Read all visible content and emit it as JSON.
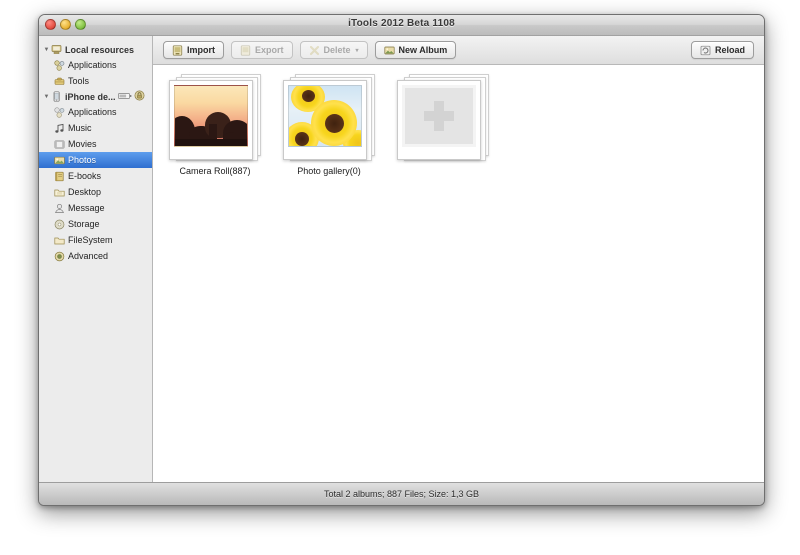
{
  "window": {
    "title": "iTools 2012 Beta 1108",
    "controls": {
      "close": "close",
      "minimize": "minimize",
      "zoom": "zoom"
    }
  },
  "sidebar": {
    "groups": [
      {
        "label": "Local resources",
        "icon": "computer-icon",
        "expanded": true,
        "items": [
          {
            "label": "Applications",
            "icon": "applications-icon",
            "selected": false
          },
          {
            "label": "Tools",
            "icon": "tools-icon",
            "selected": false
          }
        ]
      },
      {
        "label": "iPhone de...",
        "icon": "iphone-icon",
        "expanded": true,
        "battery": "battery-icon",
        "lock": "lock-icon",
        "items": [
          {
            "label": "Applications",
            "icon": "applications-icon",
            "selected": false
          },
          {
            "label": "Music",
            "icon": "music-note-icon",
            "selected": false
          },
          {
            "label": "Movies",
            "icon": "movies-icon",
            "selected": false
          },
          {
            "label": "Photos",
            "icon": "photos-icon",
            "selected": true
          },
          {
            "label": "E-books",
            "icon": "ebooks-icon",
            "selected": false
          },
          {
            "label": "Desktop",
            "icon": "desktop-folder-icon",
            "selected": false
          },
          {
            "label": "Message",
            "icon": "message-icon",
            "selected": false
          },
          {
            "label": "Storage",
            "icon": "storage-icon",
            "selected": false
          },
          {
            "label": "FileSystem",
            "icon": "filesystem-folder-icon",
            "selected": false
          },
          {
            "label": "Advanced",
            "icon": "advanced-gear-icon",
            "selected": false
          }
        ]
      }
    ]
  },
  "toolbar": {
    "import_label": "Import",
    "export_label": "Export",
    "delete_label": "Delete",
    "delete_caret": "▾",
    "new_album_label": "New Album",
    "reload_label": "Reload"
  },
  "albums": [
    {
      "label": "Camera Roll(887)",
      "thumb": "sunset-photo",
      "count": 887
    },
    {
      "label": "Photo gallery(0)",
      "thumb": "sunflower-photo",
      "count": 0
    },
    {
      "label": "",
      "thumb": "add-album-placeholder",
      "count": null
    }
  ],
  "statusbar": {
    "text": "Total 2 albums; 887 Files;  Size: 1,3 GB"
  },
  "colors": {
    "selection": "#2f6fd0",
    "sidebar_bg": "#ececec",
    "content_bg": "#ffffff",
    "titlebar": "#d6d6d6"
  }
}
